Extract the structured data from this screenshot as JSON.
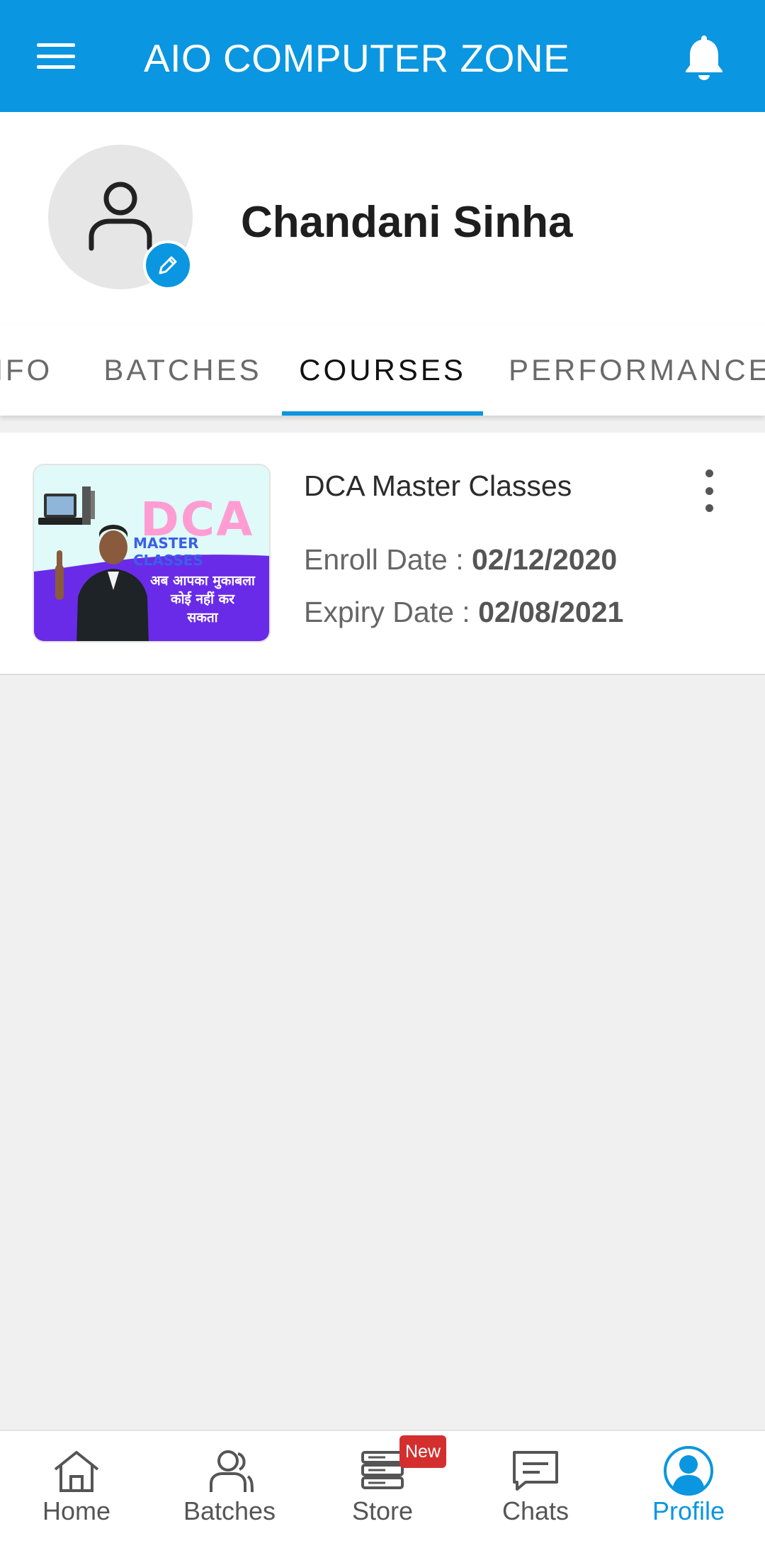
{
  "app_bar": {
    "title": "AIO COMPUTER ZONE",
    "menu_icon": "hamburger-menu-icon",
    "notification_icon": "bell-icon"
  },
  "profile": {
    "name": "Chandani Sinha",
    "avatar_icon": "person-icon",
    "edit_icon": "pencil-icon"
  },
  "tabs": [
    {
      "label": "INFO",
      "active": false
    },
    {
      "label": "BATCHES",
      "active": false
    },
    {
      "label": "COURSES",
      "active": true
    },
    {
      "label": "PERFORMANCE",
      "active": false
    }
  ],
  "courses": [
    {
      "title": "DCA Master Classes",
      "thumbnail": {
        "headline": "DCA",
        "subheadline": "MASTER CLASSES",
        "tagline_line1": "अब आपका मुकाबला",
        "tagline_line2": "कोई नहीं कर",
        "tagline_line3": "सकता"
      },
      "enroll_label": "Enroll Date : ",
      "enroll_date": "02/12/2020",
      "expiry_label": "Expiry Date : ",
      "expiry_date": "02/08/2021",
      "menu_icon": "more-vertical-icon"
    }
  ],
  "bottom_nav": [
    {
      "label": "Home",
      "icon": "home-icon",
      "active": false
    },
    {
      "label": "Batches",
      "icon": "users-icon",
      "active": false
    },
    {
      "label": "Store",
      "icon": "store-icon",
      "active": false,
      "badge": "New"
    },
    {
      "label": "Chats",
      "icon": "chat-icon",
      "active": false
    },
    {
      "label": "Profile",
      "icon": "profile-icon",
      "active": true
    }
  ],
  "colors": {
    "primary": "#0a96e0",
    "badge_red": "#d32f2f",
    "background": "#f0f0f0"
  }
}
